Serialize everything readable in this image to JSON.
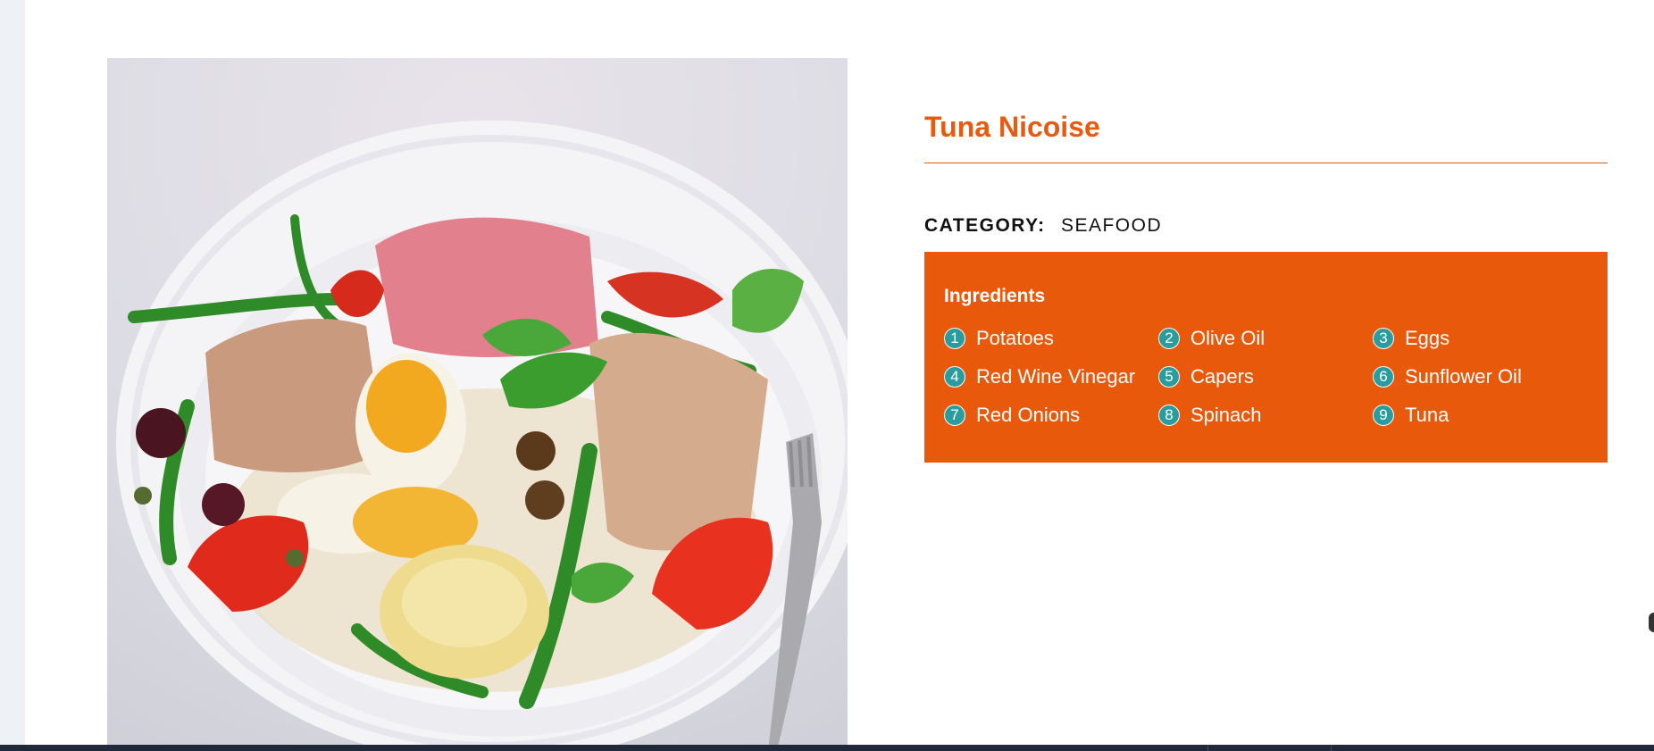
{
  "recipe": {
    "title": "Tuna Nicoise",
    "category_label": "CATEGORY:",
    "category_value": "SEAFOOD",
    "ingredients_heading": "Ingredients",
    "ingredients": [
      {
        "number": "1",
        "name": "Potatoes"
      },
      {
        "number": "2",
        "name": "Olive Oil"
      },
      {
        "number": "3",
        "name": "Eggs"
      },
      {
        "number": "4",
        "name": "Red Wine Vinegar"
      },
      {
        "number": "5",
        "name": "Capers"
      },
      {
        "number": "6",
        "name": "Sunflower Oil"
      },
      {
        "number": "7",
        "name": "Red Onions"
      },
      {
        "number": "8",
        "name": "Spinach"
      },
      {
        "number": "9",
        "name": "Tuna"
      }
    ]
  },
  "colors": {
    "accent": "#e85a0f",
    "number_badge": "#2a9c9e",
    "page_bg": "#eef2f7"
  }
}
